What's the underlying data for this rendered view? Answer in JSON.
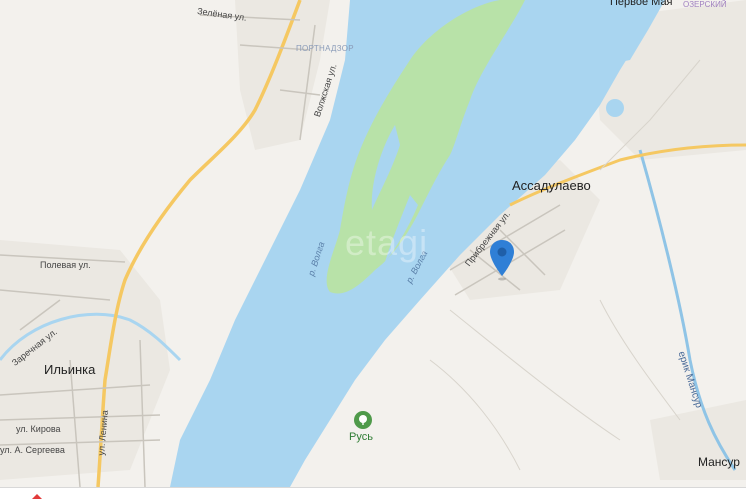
{
  "map": {
    "towns": {
      "top_village": "Первое Мая",
      "assadulaevo": "Ассадулаево",
      "ilinka": "Ильинка",
      "mansur": "Мансур"
    },
    "districts": {
      "portnadzor": "ПОРТНАДЗОР",
      "top_right_brand": "ОЗЕРСКИЙ"
    },
    "streets": {
      "zelenaya": "Зелёная ул.",
      "volzhskaya": "Волжская ул.",
      "polevaya": "Полевая ул.",
      "zarechnaya": "Заречная ул.",
      "lenina": "ул. Ленина",
      "kirova": "ул. Кирова",
      "sergeeva": "ул. А. Сергеева",
      "pribrezhnaya": "Прибрежная ул."
    },
    "water": {
      "volga_1": "р. Волга",
      "volga_2": "р. Волга",
      "erik": "ерик Мансур"
    },
    "poi": {
      "rus": "Русь"
    },
    "watermark": "etagi",
    "marker_icon": "map-pin-icon",
    "colors": {
      "river": "#a9d5f0",
      "island": "#b8e2a8",
      "land": "#f3f1ed",
      "road_major": "#f5c862",
      "marker": "#2f7fd6"
    }
  }
}
